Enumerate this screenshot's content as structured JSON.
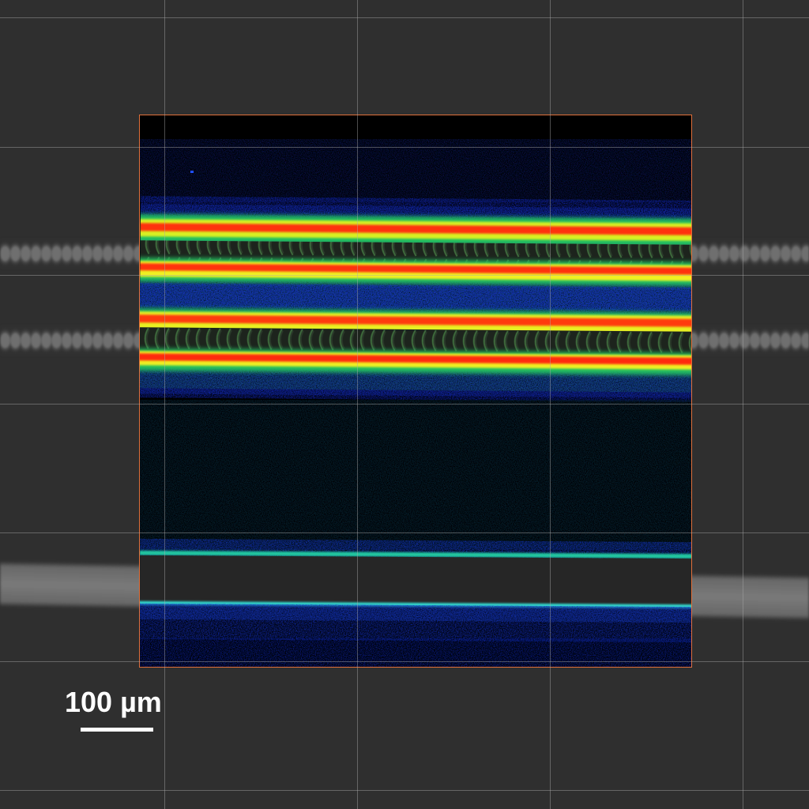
{
  "image": {
    "background_color": "#2f2f2f",
    "map_border_color": "#e0703a",
    "colormap": [
      "#000000",
      "#0a1a8a",
      "#1a3fd0",
      "#20c060",
      "#c8f020",
      "#ffe020",
      "#ff2a10"
    ]
  },
  "scale_bar": {
    "label": "100 µm",
    "color": "#ffffff"
  }
}
